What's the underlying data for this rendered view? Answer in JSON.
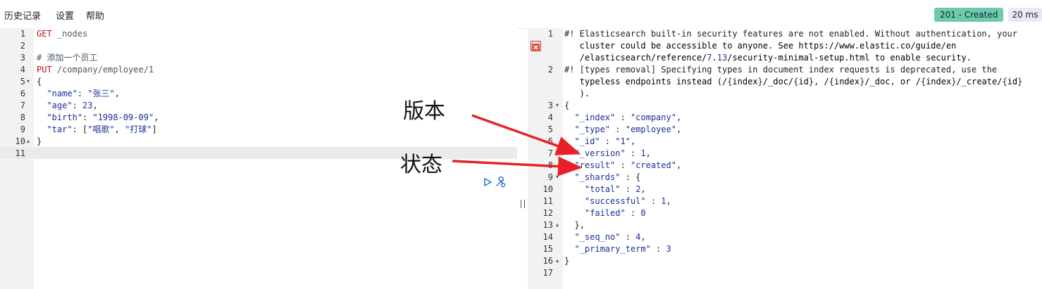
{
  "menu": {
    "history": "历史记录",
    "settings": "设置",
    "help": "帮助"
  },
  "response_status": {
    "status": "201 - Created",
    "timing": "20 ms"
  },
  "request_lines": [
    {
      "n": "1",
      "t": "GET _nodes"
    },
    {
      "n": "2",
      "t": ""
    },
    {
      "n": "3",
      "t": "# 添加一个员工"
    },
    {
      "n": "4",
      "t": "PUT /company/employee/1"
    },
    {
      "n": "5",
      "t": "{"
    },
    {
      "n": "6",
      "t": "  \"name\": \"张三\","
    },
    {
      "n": "7",
      "t": "  \"age\": 23,"
    },
    {
      "n": "8",
      "t": "  \"birth\": \"1998-09-09\","
    },
    {
      "n": "9",
      "t": "  \"tar\": [\"唱歌\", \"打球\"]"
    },
    {
      "n": "10",
      "t": "}"
    },
    {
      "n": "11",
      "t": ""
    }
  ],
  "response_lines": [
    {
      "n": "1",
      "t": "#! Elasticsearch built-in security features are not enabled. Without authentication, your"
    },
    {
      "n": "",
      "t": "   cluster could be accessible to anyone. See https://www.elastic.co/guide/en"
    },
    {
      "n": "",
      "t": "   /elasticsearch/reference/7.13/security-minimal-setup.html to enable security."
    },
    {
      "n": "2",
      "t": "#! [types removal] Specifying types in document index requests is deprecated, use the"
    },
    {
      "n": "",
      "t": "   typeless endpoints instead (/{index}/_doc/{id}, /{index}/_doc, or /{index}/_create/{id}"
    },
    {
      "n": "",
      "t": "   )."
    },
    {
      "n": "3",
      "t": "{"
    },
    {
      "n": "4",
      "t": "  \"_index\" : \"company\","
    },
    {
      "n": "5",
      "t": "  \"_type\" : \"employee\","
    },
    {
      "n": "6",
      "t": "  \"_id\" : \"1\","
    },
    {
      "n": "7",
      "t": "  \"_version\" : 1,"
    },
    {
      "n": "8",
      "t": "  \"result\" : \"created\","
    },
    {
      "n": "9",
      "t": "  \"_shards\" : {"
    },
    {
      "n": "10",
      "t": "    \"total\" : 2,"
    },
    {
      "n": "11",
      "t": "    \"successful\" : 1,"
    },
    {
      "n": "12",
      "t": "    \"failed\" : 0"
    },
    {
      "n": "13",
      "t": "  },"
    },
    {
      "n": "14",
      "t": "  \"_seq_no\" : 4,"
    },
    {
      "n": "15",
      "t": "  \"_primary_term\" : 3"
    },
    {
      "n": "16",
      "t": "}"
    },
    {
      "n": "17",
      "t": ""
    }
  ],
  "annotations": {
    "version_label": "版本",
    "status_label": "状态"
  },
  "colors": {
    "status_green": "#6dcbad",
    "arrow_red": "#e8202a",
    "method_red": "#b5121b",
    "value_blue": "#1a2f95"
  },
  "icons": {
    "run": "play-icon",
    "settings": "wrench-icon",
    "warning": "error-icon"
  }
}
